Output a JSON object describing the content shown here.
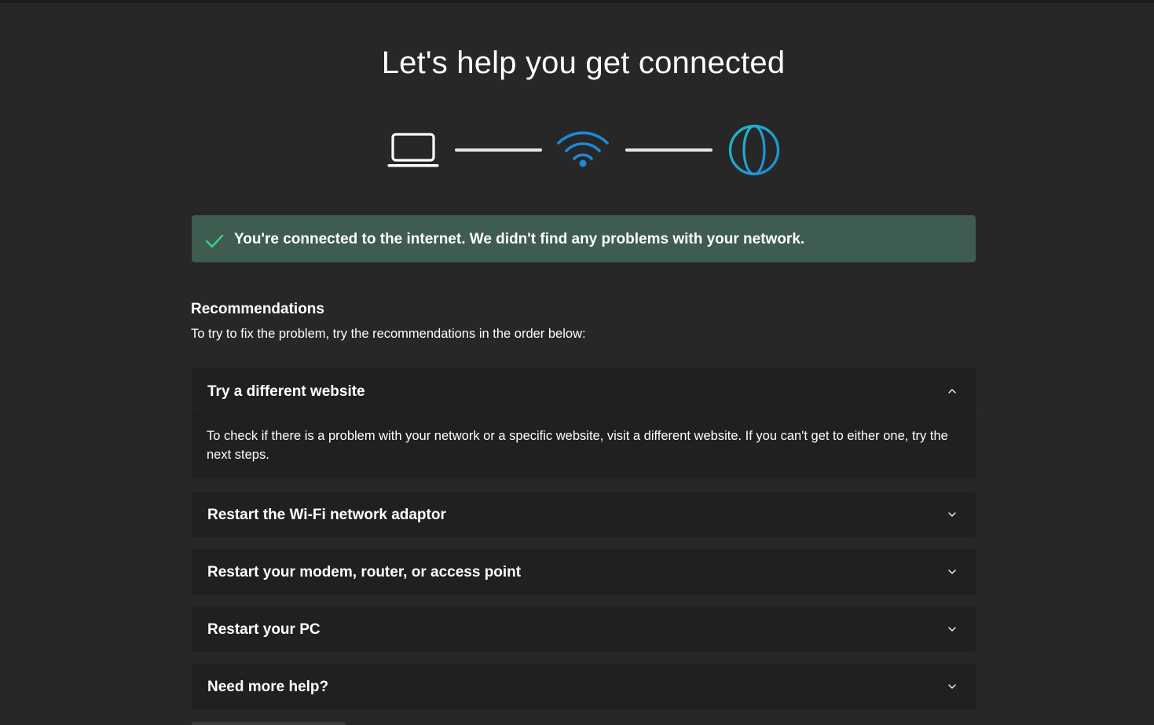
{
  "page": {
    "title": "Let's help you get connected"
  },
  "diagram": {
    "icons": [
      "laptop-icon",
      "wifi-icon",
      "globe-icon"
    ],
    "status": "connected",
    "accent_wifi": "#1e88d6",
    "accent_globe": "#2ab0d6"
  },
  "banner": {
    "text": "You're connected to the internet. We didn't find any problems with your network.",
    "icon": "checkmark-icon",
    "background": "#3f5c50",
    "icon_color": "#3ccf8e"
  },
  "recommendations": {
    "title": "Recommendations",
    "subtitle": "To try to fix the problem, try the recommendations in the order below:",
    "items": [
      {
        "label": "Try a different website",
        "expanded": true,
        "body": "To check if there is a problem with your network or a specific website, visit a different website. If you can't get to either one, try the next steps."
      },
      {
        "label": "Restart the Wi-Fi network adaptor",
        "expanded": false
      },
      {
        "label": "Restart your modem, router, or access point",
        "expanded": false
      },
      {
        "label": "Restart your PC",
        "expanded": false
      },
      {
        "label": "Need more help?",
        "expanded": false
      }
    ]
  }
}
